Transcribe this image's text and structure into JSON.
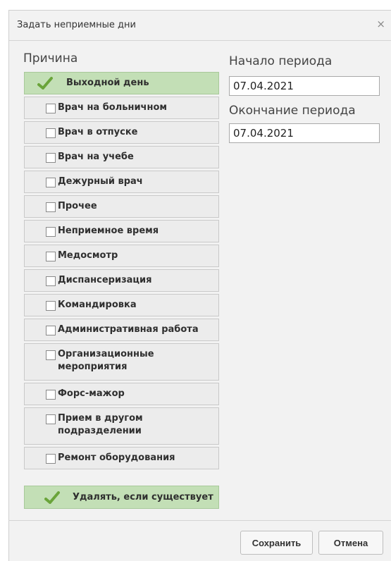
{
  "dialog": {
    "title": "Задать неприемные дни",
    "close_icon": "×"
  },
  "reason_section": {
    "label": "Причина"
  },
  "reasons": [
    {
      "label": "Выходной день",
      "checked": true
    },
    {
      "label": "Врач на больничном",
      "checked": false
    },
    {
      "label": "Врач в отпуске",
      "checked": false
    },
    {
      "label": "Врач на учебе",
      "checked": false
    },
    {
      "label": "Дежурный врач",
      "checked": false
    },
    {
      "label": "Прочее",
      "checked": false
    },
    {
      "label": "Неприемное время",
      "checked": false
    },
    {
      "label": "Медосмотр",
      "checked": false
    },
    {
      "label": "Диспансеризация",
      "checked": false
    },
    {
      "label": "Командировка",
      "checked": false
    },
    {
      "label": "Административная работа",
      "checked": false
    },
    {
      "label": "Организационные мероприятия",
      "checked": false
    },
    {
      "label": "Форс-мажор",
      "checked": false
    },
    {
      "label": "Прием в другом подразделении",
      "checked": false
    },
    {
      "label": "Ремонт оборудования",
      "checked": false
    }
  ],
  "period": {
    "start_label": "Начало периода",
    "start_value": "07.04.2021",
    "end_label": "Окончание периода",
    "end_value": "07.04.2021"
  },
  "delete_if_exists": {
    "label": "Удалять, если существует",
    "checked": true
  },
  "buttons": {
    "save": "Сохранить",
    "cancel": "Отмена"
  },
  "colors": {
    "selected_bg": "#c3dfb6",
    "check_green": "#6aa43a"
  }
}
